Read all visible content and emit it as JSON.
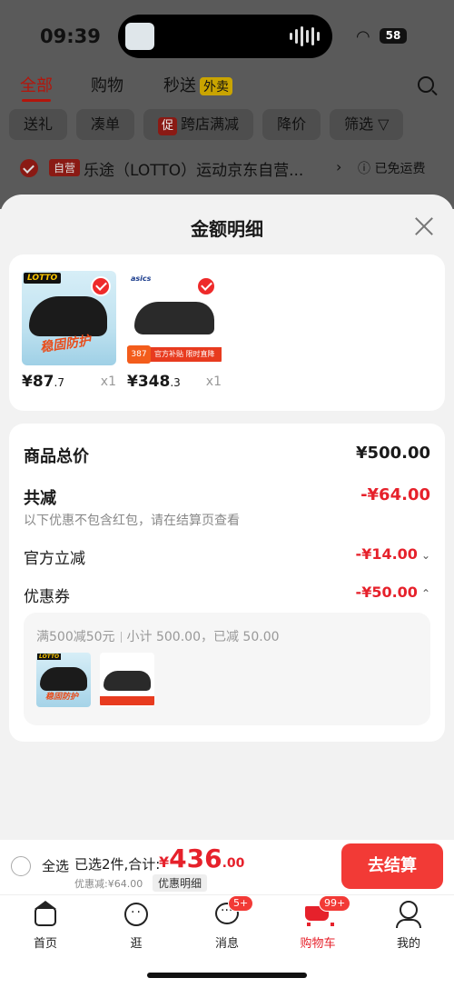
{
  "status_bar": {
    "time": "09:39",
    "battery": "58"
  },
  "background": {
    "tabs": [
      "全部",
      "购物",
      "秒送"
    ],
    "waimai_badge": "外卖",
    "filters": [
      "送礼",
      "凑单",
      "跨店满减",
      "降价",
      "筛选 ▽"
    ],
    "promo_tag": "促",
    "store_badge": "自营",
    "store_name": "乐途（LOTTO）运动京东自营...",
    "shipping": "已免运费"
  },
  "sheet": {
    "title": "金额明细",
    "products": [
      {
        "brand": "LOTTO",
        "slogan": "稳固防护",
        "price_main": "¥87",
        "price_dec": ".7",
        "qty": "x1"
      },
      {
        "brand": "asics",
        "tag_price": "387",
        "promo": "官方补贴 限时直降",
        "price_main": "¥348",
        "price_dec": ".3",
        "qty": "x1"
      }
    ],
    "summary": {
      "total_label": "商品总价",
      "total_value": "¥500.00",
      "reduce_label": "共减",
      "reduce_value": "-¥64.00",
      "note": "以下优惠不包含红包，请在结算页查看",
      "official_label": "官方立减",
      "official_value": "-¥14.00",
      "coupon_label": "优惠券",
      "coupon_value": "-¥50.00",
      "coupon_rule": "满500减50元",
      "coupon_detail": "小计 500.00，已减 50.00"
    }
  },
  "checkout": {
    "select_all": "全选",
    "selected_info": "已选2件,合计:",
    "currency": "¥",
    "price_int": "436",
    "price_dec": ".00",
    "discount": "优惠减:¥64.00",
    "detail_btn": "优惠明细",
    "checkout_btn": "去结算"
  },
  "tabbar": {
    "items": [
      {
        "label": "首页",
        "icon": "home-icon"
      },
      {
        "label": "逛",
        "icon": "browse-icon"
      },
      {
        "label": "消息",
        "icon": "message-icon",
        "badge": "5+"
      },
      {
        "label": "购物车",
        "icon": "cart-icon",
        "badge": "99+"
      },
      {
        "label": "我的",
        "icon": "profile-icon"
      }
    ]
  },
  "colors": {
    "accent_red": "#e6212b",
    "checkout_red": "#f23a36"
  }
}
